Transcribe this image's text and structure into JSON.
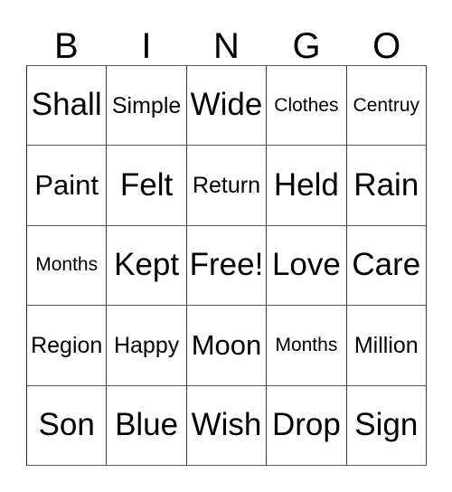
{
  "card": {
    "type": "bingo-card",
    "columns": 5,
    "rows": 5,
    "header": {
      "letters": [
        "B",
        "I",
        "N",
        "G",
        "O"
      ]
    },
    "colors": {
      "background": "#ffffff",
      "text": "#000000",
      "grid_line": "#3a3a3a"
    },
    "cells": [
      [
        {
          "text": "Shall",
          "size": "xl"
        },
        {
          "text": "Simple",
          "size": "md"
        },
        {
          "text": "Wide",
          "size": "xl"
        },
        {
          "text": "Clothes",
          "size": "sm"
        },
        {
          "text": "Centruy",
          "size": "sm"
        }
      ],
      [
        {
          "text": "Paint",
          "size": "lg"
        },
        {
          "text": "Felt",
          "size": "xl"
        },
        {
          "text": "Return",
          "size": "md"
        },
        {
          "text": "Held",
          "size": "xl"
        },
        {
          "text": "Rain",
          "size": "xl"
        }
      ],
      [
        {
          "text": "Months",
          "size": "sm"
        },
        {
          "text": "Kept",
          "size": "xl"
        },
        {
          "text": "Free!",
          "size": "xl"
        },
        {
          "text": "Love",
          "size": "xl"
        },
        {
          "text": "Care",
          "size": "xl"
        }
      ],
      [
        {
          "text": "Region",
          "size": "md"
        },
        {
          "text": "Happy",
          "size": "md"
        },
        {
          "text": "Moon",
          "size": "lg"
        },
        {
          "text": "Months",
          "size": "sm"
        },
        {
          "text": "Million",
          "size": "md"
        }
      ],
      [
        {
          "text": "Son",
          "size": "xl"
        },
        {
          "text": "Blue",
          "size": "xl"
        },
        {
          "text": "Wish",
          "size": "xl"
        },
        {
          "text": "Drop",
          "size": "xl"
        },
        {
          "text": "Sign",
          "size": "xl"
        }
      ]
    ]
  }
}
